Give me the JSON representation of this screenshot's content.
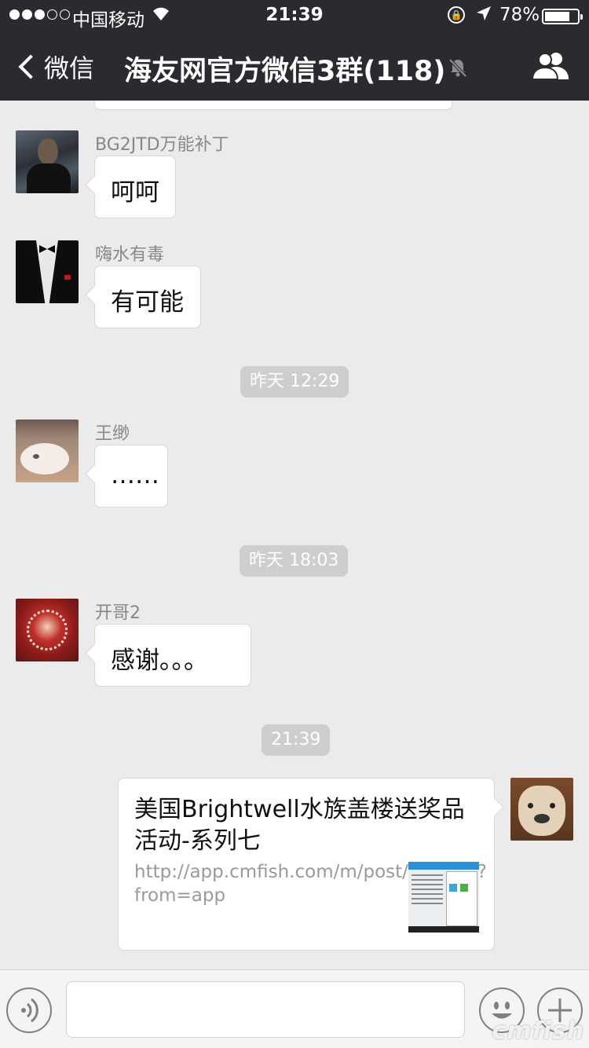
{
  "status_bar": {
    "carrier": "中国移动",
    "time": "21:39",
    "battery_percent_text": "78%",
    "battery_level": 0.78
  },
  "nav": {
    "back_label": "微信",
    "title": "海友网官方微信3群(118)"
  },
  "messages": [
    {
      "sender": "BG2JTD万能补丁",
      "text": "呵呵"
    },
    {
      "sender": "嗨水有毒",
      "text": "有可能"
    },
    {
      "timestamp": "昨天 12:29"
    },
    {
      "sender": "王缈",
      "text": "……"
    },
    {
      "timestamp": "昨天 18:03"
    },
    {
      "sender": "开哥2",
      "text": "感谢。。。"
    },
    {
      "timestamp": "21:39"
    }
  ],
  "link_card": {
    "title": "美国Brightwell水族盖楼送奖品活动-系列七",
    "url": "http://app.cmfish.com/m/post/477143?from=app"
  },
  "watermark": "cmfish",
  "colors": {
    "nav_bg": "#2b2b2f",
    "chat_bg": "#ebebeb",
    "bubble": "#ffffff",
    "timestamp_pill": "#cecece"
  },
  "icons": [
    "back-chevron-icon",
    "wifi-icon",
    "orientation-lock-icon",
    "location-arrow-icon",
    "battery-icon",
    "mute-icon",
    "group-members-icon",
    "voice-icon",
    "emoji-icon",
    "plus-icon"
  ]
}
